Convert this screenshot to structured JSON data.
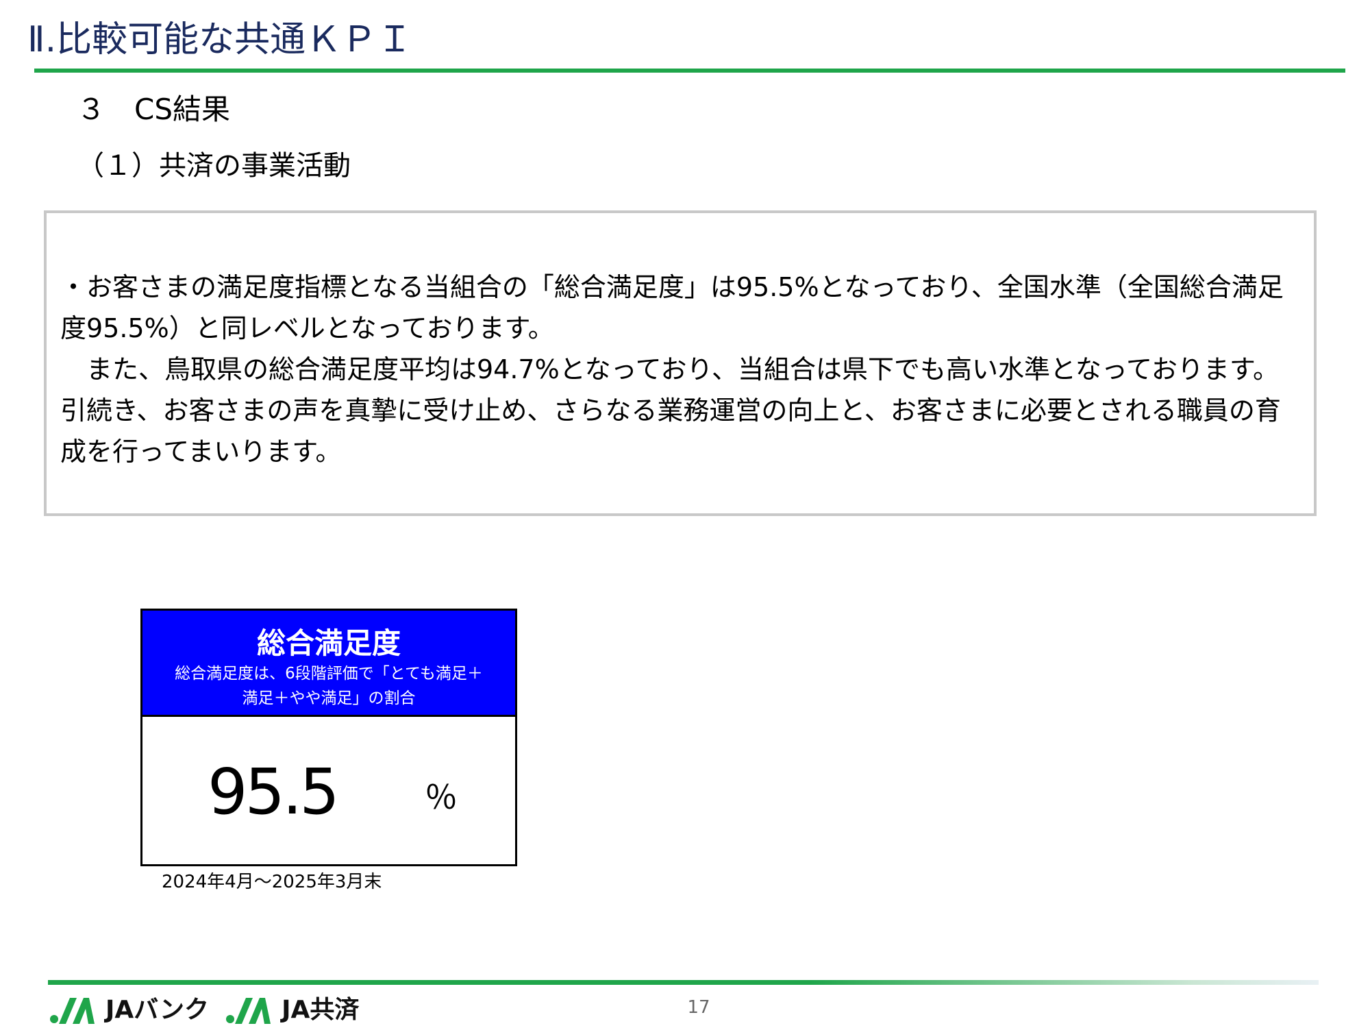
{
  "header": {
    "title": "Ⅱ.比較可能な共通ＫＰＩ"
  },
  "section": {
    "heading": "３　CS結果",
    "subheading": "（１）共済の事業活動"
  },
  "summary": {
    "lines": [
      "・お客さまの満足度指標となる当組合の「総合満足度」は95.5%となっており、全国水準（全国総合満足度95.5%）と同レベルとなっております。",
      "　また、鳥取県の総合満足度平均は94.7%となっており、当組合は県下でも高い水準となっております。",
      "引続き、お客さまの声を真摯に受け止め、さらなる業務運営の向上と、お客さまに必要とされる職員の育成を行ってまいります。"
    ]
  },
  "kpi_card": {
    "title": "総合満足度",
    "description": "総合満足度は、6段階評価で「とても満足＋満足＋やや満足」の割合",
    "value": "95.5",
    "unit": "％",
    "period": "2024年4月～2025年3月末",
    "header_color": "#0000ff"
  },
  "footer": {
    "logos": [
      {
        "name": "JAバンク",
        "icon": "ja-logo-icon"
      },
      {
        "name": "JA共済",
        "icon": "ja-logo-icon"
      }
    ],
    "page_number": "17",
    "accent_color": "#1fa54a"
  }
}
